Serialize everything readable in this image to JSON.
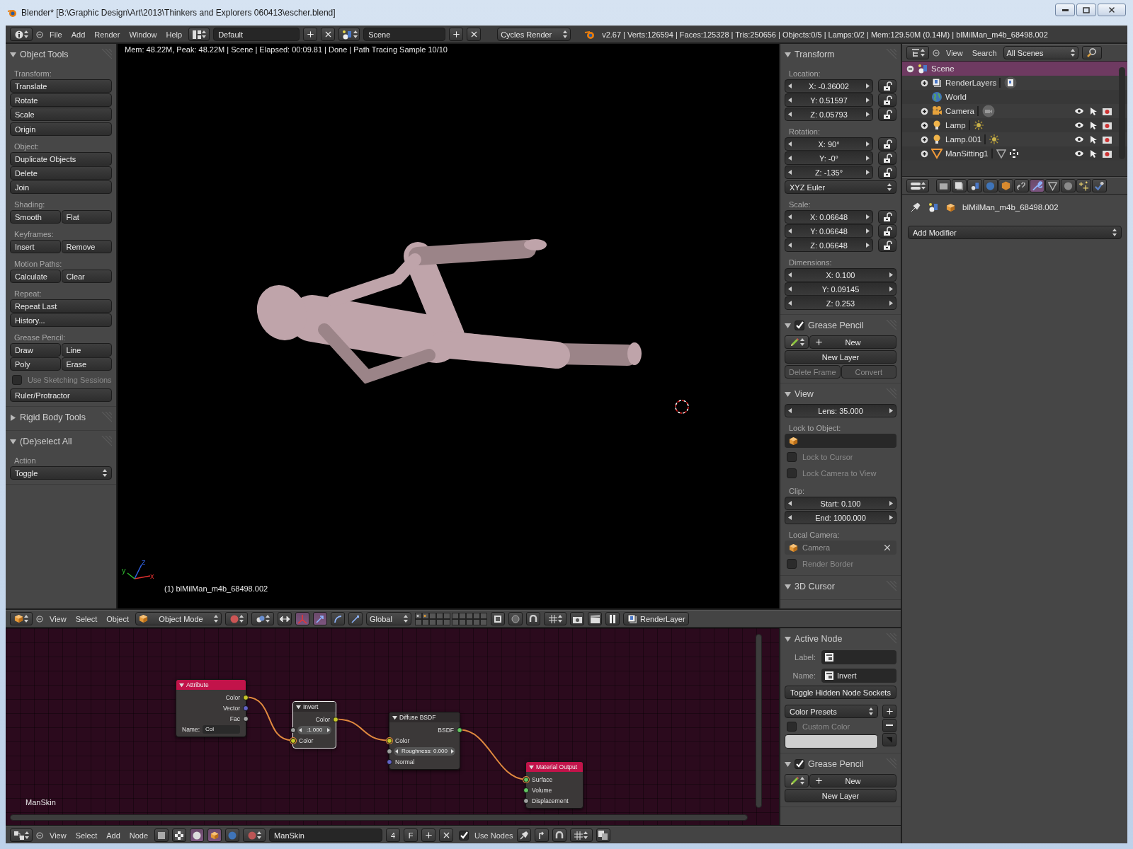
{
  "window": {
    "title": "Blender* [B:\\Graphic Design\\Art\\2013\\Thinkers and Explorers 060413\\escher.blend]"
  },
  "info_header": {
    "menus": [
      "File",
      "Add",
      "Render",
      "Window",
      "Help"
    ],
    "layout": "Default",
    "scene": "Scene",
    "engine": "Cycles Render",
    "stats": "v2.67 | Verts:126594 | Faces:125328 | Tris:250656 | Objects:0/5 | Lamps:0/2 | Mem:129.50M (0.14M) | blMilMan_m4b_68498.002"
  },
  "tool_shelf": {
    "panels": [
      {
        "title": "Object Tools",
        "expanded": true,
        "items": [
          {
            "kind": "label",
            "text": "Transform:"
          },
          {
            "kind": "buttons",
            "rows": [
              [
                "Translate"
              ],
              [
                "Rotate"
              ],
              [
                "Scale"
              ]
            ]
          },
          {
            "kind": "buttons",
            "rows": [
              [
                "Origin"
              ]
            ]
          },
          {
            "kind": "label",
            "text": "Object:"
          },
          {
            "kind": "buttons",
            "rows": [
              [
                "Duplicate Objects"
              ],
              [
                "Delete"
              ],
              [
                "Join"
              ]
            ]
          },
          {
            "kind": "label",
            "text": "Shading:"
          },
          {
            "kind": "buttons",
            "rows": [
              [
                "Smooth",
                "Flat"
              ]
            ]
          },
          {
            "kind": "label",
            "text": "Keyframes:"
          },
          {
            "kind": "buttons",
            "rows": [
              [
                "Insert",
                "Remove"
              ]
            ]
          },
          {
            "kind": "label",
            "text": "Motion Paths:"
          },
          {
            "kind": "buttons",
            "rows": [
              [
                "Calculate",
                "Clear"
              ]
            ]
          },
          {
            "kind": "label",
            "text": "Repeat:"
          },
          {
            "kind": "buttons",
            "rows": [
              [
                "Repeat Last"
              ],
              [
                "History..."
              ]
            ]
          },
          {
            "kind": "label",
            "text": "Grease Pencil:"
          },
          {
            "kind": "buttons",
            "rows": [
              [
                "Draw",
                "Line"
              ],
              [
                "Poly",
                "Erase"
              ]
            ]
          },
          {
            "kind": "checkbox",
            "label": "Use Sketching Sessions",
            "checked": false
          },
          {
            "kind": "buttons",
            "rows": [
              [
                "Ruler/Protractor"
              ]
            ]
          }
        ]
      },
      {
        "title": "Rigid Body Tools",
        "expanded": false
      },
      {
        "title": "(De)select All",
        "expanded": true,
        "items": [
          {
            "kind": "label",
            "text": "Action"
          },
          {
            "kind": "select",
            "value": "Toggle"
          }
        ]
      }
    ]
  },
  "viewport": {
    "info": "Mem: 48.22M, Peak: 48.22M | Scene | Elapsed: 00:09.81 | Done | Path Tracing Sample 10/10",
    "object_label": "(1) blMilMan_m4b_68498.002",
    "axes": [
      "x",
      "y",
      "z"
    ]
  },
  "view3d_panel": {
    "panels": [
      {
        "title": "Transform",
        "expanded": true,
        "items": [
          {
            "kind": "label",
            "text": "Location:"
          },
          {
            "kind": "vector",
            "rows": [
              {
                "text": "X: -0.36002",
                "locked": false
              },
              {
                "text": "Y: 0.51597",
                "locked": false
              },
              {
                "text": "Z: 0.05793",
                "locked": false
              }
            ]
          },
          {
            "kind": "label",
            "text": "Rotation:"
          },
          {
            "kind": "vector",
            "rows": [
              {
                "text": "X: 90°",
                "locked": false
              },
              {
                "text": "Y: -0°",
                "locked": false
              },
              {
                "text": "Z: -135°",
                "locked": false
              }
            ]
          },
          {
            "kind": "select",
            "value": "XYZ Euler"
          },
          {
            "kind": "label",
            "text": "Scale:"
          },
          {
            "kind": "vector",
            "rows": [
              {
                "text": "X: 0.06648",
                "locked": false
              },
              {
                "text": "Y: 0.06648",
                "locked": false
              },
              {
                "text": "Z: 0.06648",
                "locked": false
              }
            ]
          },
          {
            "kind": "label",
            "text": "Dimensions:"
          },
          {
            "kind": "vector",
            "rows": [
              {
                "text": "X: 0.100"
              },
              {
                "text": "Y: 0.09145"
              },
              {
                "text": "Z: 0.253"
              }
            ]
          }
        ]
      },
      {
        "title": "Grease Pencil",
        "expanded": true,
        "checked": true,
        "items": [
          {
            "kind": "gp_new",
            "label": "New"
          },
          {
            "kind": "buttons",
            "rows": [
              [
                "New Layer"
              ]
            ]
          },
          {
            "kind": "buttons",
            "rows": [
              [
                "Delete Frame",
                "Convert"
              ]
            ],
            "disabled": true
          }
        ]
      },
      {
        "title": "View",
        "expanded": true,
        "items": [
          {
            "kind": "vector",
            "rows": [
              {
                "text": "Lens: 35.000"
              }
            ]
          },
          {
            "kind": "label",
            "text": "Lock to Object:"
          },
          {
            "kind": "object_field"
          },
          {
            "kind": "checkbox",
            "label": "Lock to Cursor",
            "checked": false
          },
          {
            "kind": "checkbox",
            "label": "Lock Camera to View",
            "checked": false
          },
          {
            "kind": "label",
            "text": "Clip:"
          },
          {
            "kind": "vector",
            "rows": [
              {
                "text": "Start: 0.100"
              },
              {
                "text": "End: 1000.000"
              }
            ]
          },
          {
            "kind": "label",
            "text": "Local Camera:"
          },
          {
            "kind": "object_field",
            "text": "Camera",
            "clear": true
          },
          {
            "kind": "checkbox",
            "label": "Render Border",
            "checked": false
          }
        ]
      },
      {
        "title": "3D Cursor",
        "expanded": true
      }
    ]
  },
  "view3d_header": {
    "menus": [
      "View",
      "Select",
      "Object"
    ],
    "mode": "Object Mode",
    "orientation": "Global",
    "render_layer": "RenderLayer"
  },
  "node_editor": {
    "material_label": "ManSkin",
    "nodes": [
      {
        "title": "Attribute",
        "color": "#c2134a",
        "selected": false,
        "rows": [
          {
            "kind": "output",
            "label": "Color",
            "color": "#c7c729"
          },
          {
            "kind": "output",
            "label": "Vector",
            "color": "#6363c7"
          },
          {
            "kind": "output",
            "label": "Fac",
            "color": "#a1a1a1"
          },
          {
            "kind": "name",
            "label": "Name:",
            "value": "Col"
          }
        ]
      },
      {
        "title": "Invert",
        "color": "#2f2b2c",
        "selected": true,
        "rows": [
          {
            "kind": "output",
            "label": "Color",
            "color": "#c7c729"
          },
          {
            "kind": "value",
            "text": ":1.000",
            "color": "#a1a1a1",
            "linked": false
          },
          {
            "kind": "input",
            "label": "Color",
            "color": "#c7c729",
            "linked": true
          }
        ]
      },
      {
        "title": "Diffuse BSDF",
        "color": "#2f2b2c",
        "selected": false,
        "rows": [
          {
            "kind": "output",
            "label": "BSDF",
            "color": "#63c763"
          },
          {
            "kind": "input",
            "label": "Color",
            "color": "#c7c729",
            "linked": true
          },
          {
            "kind": "value",
            "text": "Roughness: 0.000",
            "color": "#a1a1a1",
            "linked": false
          },
          {
            "kind": "input",
            "label": "Normal",
            "color": "#6363c7",
            "linked": false
          }
        ]
      },
      {
        "title": "Material Output",
        "color": "#c2134a",
        "selected": false,
        "rows": [
          {
            "kind": "input",
            "label": "Surface",
            "color": "#63c763",
            "linked": true
          },
          {
            "kind": "input",
            "label": "Volume",
            "color": "#63c763",
            "linked": false
          },
          {
            "kind": "input",
            "label": "Displacement",
            "color": "#a1a1a1",
            "linked": false
          }
        ]
      }
    ]
  },
  "node_panel": {
    "panels": [
      {
        "title": "Active Node",
        "expanded": true,
        "items": [
          {
            "kind": "text_field",
            "label": "Label:"
          },
          {
            "kind": "text_field",
            "label": "Name:",
            "value": "Invert"
          },
          {
            "kind": "buttons",
            "rows": [
              [
                "Toggle Hidden Node Sockets"
              ]
            ]
          },
          {
            "kind": "preset_block",
            "select": "Color Presets",
            "checkbox": {
              "label": "Custom Color",
              "checked": false
            }
          }
        ]
      },
      {
        "title": "Grease Pencil",
        "expanded": true,
        "checked": true,
        "items": [
          {
            "kind": "gp_new",
            "label": "New"
          },
          {
            "kind": "buttons",
            "rows": [
              [
                "New Layer"
              ]
            ]
          }
        ]
      }
    ]
  },
  "node_header": {
    "menus": [
      "View",
      "Select",
      "Add",
      "Node"
    ],
    "material": "ManSkin",
    "users": "4",
    "fake_user": "F",
    "use_nodes": {
      "label": "Use Nodes",
      "checked": true
    }
  },
  "outliner": {
    "menus": [
      "View",
      "Search"
    ],
    "filter": "All Scenes",
    "tree": [
      {
        "label": "Scene",
        "kind": "scene",
        "selected": true,
        "expanded": true,
        "children": [
          {
            "label": "RenderLayers",
            "kind": "renderlayers",
            "selected": false,
            "expanded": false
          },
          {
            "label": "World",
            "kind": "world",
            "selected": false
          },
          {
            "label": "Camera",
            "kind": "camera",
            "selected": false,
            "expanded": false
          },
          {
            "label": "Lamp",
            "kind": "lamp",
            "selected": false,
            "expanded": false
          },
          {
            "label": "Lamp.001",
            "kind": "lamp",
            "selected": false,
            "expanded": false
          },
          {
            "label": "ManSitting1",
            "kind": "mesh",
            "selected": false,
            "expanded": false
          }
        ]
      }
    ]
  },
  "properties": {
    "tabs": [
      {
        "kind": "render",
        "selected": false
      },
      {
        "kind": "renderlayers",
        "selected": false
      },
      {
        "kind": "scene",
        "selected": false
      },
      {
        "kind": "world",
        "selected": false
      },
      {
        "kind": "object",
        "selected": false
      },
      {
        "kind": "constraints",
        "selected": false
      },
      {
        "kind": "modifiers",
        "selected": true
      },
      {
        "kind": "data",
        "selected": false
      },
      {
        "kind": "material",
        "selected": false
      },
      {
        "kind": "particles",
        "selected": false
      },
      {
        "kind": "physics",
        "selected": false
      }
    ],
    "context": "blMilMan_m4b_68498.002",
    "add_modifier": "Add Modifier"
  }
}
